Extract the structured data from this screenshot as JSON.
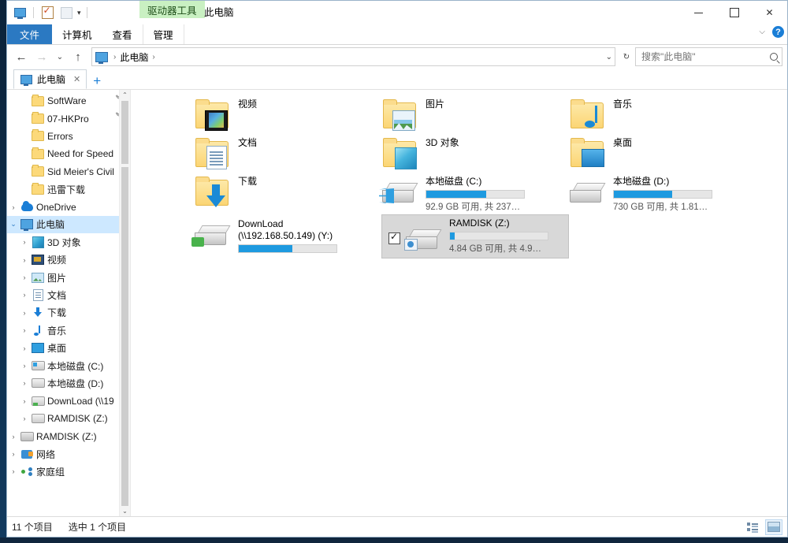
{
  "window": {
    "title": "此电脑",
    "contextual_tab_group": "驱动器工具",
    "minimize": "—",
    "maximize": "□",
    "close": "✕"
  },
  "quick_access_toolbar": {
    "items": [
      {
        "name": "properties-icon",
        "label": "属性"
      },
      {
        "name": "new-folder-icon",
        "label": "新建文件夹"
      },
      {
        "name": "customize-caret",
        "label": "▾"
      }
    ]
  },
  "ribbon": {
    "tabs": [
      {
        "label": "文件",
        "active": true
      },
      {
        "label": "计算机",
        "active": false
      },
      {
        "label": "查看",
        "active": false
      },
      {
        "label": "管理",
        "active": false
      }
    ],
    "collapse_caret": "⌵",
    "help": "?"
  },
  "addressbar": {
    "back": "←",
    "forward": "→",
    "recent_caret": "⌄",
    "up": "↑",
    "breadcrumb": [
      {
        "label": "此电脑"
      }
    ],
    "separator": "›",
    "history_caret": "⌄",
    "refresh": "↻",
    "search_placeholder": "搜索\"此电脑\""
  },
  "tabstrip": {
    "tabs": [
      {
        "label": "此电脑",
        "close": "✕"
      }
    ],
    "new_tab": "+"
  },
  "sidebar": {
    "items": [
      {
        "label": "SoftWare",
        "icon": "folder-icon",
        "indent": 1,
        "chevron": "",
        "pinned": true
      },
      {
        "label": "07-HKPro",
        "icon": "folder-icon",
        "indent": 1,
        "chevron": "",
        "pinned": true
      },
      {
        "label": "Errors",
        "icon": "folder-icon",
        "indent": 1,
        "chevron": "",
        "pinned": false
      },
      {
        "label": "Need for Speed",
        "icon": "folder-icon",
        "indent": 1,
        "chevron": "",
        "pinned": false
      },
      {
        "label": "Sid Meier's Civil",
        "icon": "folder-icon",
        "indent": 1,
        "chevron": "",
        "pinned": false
      },
      {
        "label": "迅雷下载",
        "icon": "folder-icon",
        "indent": 1,
        "chevron": "",
        "pinned": false
      },
      {
        "label": "OneDrive",
        "icon": "cloud-icon",
        "indent": 0,
        "chevron": "›",
        "pinned": false
      },
      {
        "label": "此电脑",
        "icon": "pc-icon",
        "indent": 0,
        "chevron": "⌄",
        "selected": true,
        "pinned": false
      },
      {
        "label": "3D 对象",
        "icon": "cube-icon",
        "indent": 1,
        "chevron": "›",
        "pinned": false
      },
      {
        "label": "视频",
        "icon": "video-icon",
        "indent": 1,
        "chevron": "›",
        "pinned": false
      },
      {
        "label": "图片",
        "icon": "picture-icon",
        "indent": 1,
        "chevron": "›",
        "pinned": false
      },
      {
        "label": "文档",
        "icon": "document-icon",
        "indent": 1,
        "chevron": "›",
        "pinned": false
      },
      {
        "label": "下载",
        "icon": "download-icon",
        "indent": 1,
        "chevron": "›",
        "pinned": false
      },
      {
        "label": "音乐",
        "icon": "music-icon",
        "indent": 1,
        "chevron": "›",
        "pinned": false
      },
      {
        "label": "桌面",
        "icon": "desktop-icon",
        "indent": 1,
        "chevron": "›",
        "pinned": false
      },
      {
        "label": "本地磁盘 (C:)",
        "icon": "windows-drive-icon",
        "indent": 1,
        "chevron": "›",
        "pinned": false
      },
      {
        "label": "本地磁盘 (D:)",
        "icon": "drive-icon",
        "indent": 1,
        "chevron": "›",
        "pinned": false
      },
      {
        "label": "DownLoad (\\\\19",
        "icon": "network-drive-icon",
        "indent": 1,
        "chevron": "›",
        "pinned": false
      },
      {
        "label": "RAMDISK (Z:)",
        "icon": "drive-icon",
        "indent": 1,
        "chevron": "›",
        "pinned": false
      },
      {
        "label": "RAMDISK (Z:)",
        "icon": "drive-plain-icon",
        "indent": 0,
        "chevron": "›",
        "pinned": false
      },
      {
        "label": "网络",
        "icon": "network-icon",
        "indent": 0,
        "chevron": "›",
        "pinned": false
      },
      {
        "label": "家庭组",
        "icon": "homegroup-icon",
        "indent": 0,
        "chevron": "›",
        "pinned": false
      }
    ],
    "scroll_up": "⌃",
    "scroll_down": "⌄"
  },
  "content": {
    "folders": [
      {
        "label": "视频",
        "icon": "video-folder-icon"
      },
      {
        "label": "图片",
        "icon": "picture-folder-icon"
      },
      {
        "label": "音乐",
        "icon": "music-folder-icon"
      },
      {
        "label": "文档",
        "icon": "document-folder-icon"
      },
      {
        "label": "3D 对象",
        "icon": "cube-folder-icon"
      },
      {
        "label": "桌面",
        "icon": "desktop-folder-icon"
      },
      {
        "label": "下载",
        "icon": "download-folder-icon"
      }
    ],
    "drives": [
      {
        "label": "本地磁盘 (C:)",
        "icon": "windows-drive-icon",
        "capacity_text": "92.9 GB 可用, 共 237…",
        "used_percent": 61,
        "selected": false
      },
      {
        "label": "本地磁盘 (D:)",
        "icon": "drive-icon",
        "capacity_text": "730 GB 可用, 共 1.81…",
        "used_percent": 60,
        "selected": false
      },
      {
        "label": "DownLoad (\\\\192.168.50.149) (Y:)",
        "icon": "network-drive-icon",
        "capacity_text": "",
        "used_percent": 55,
        "selected": false
      },
      {
        "label": "RAMDISK (Z:)",
        "icon": "share-drive-icon",
        "capacity_text": "4.84 GB 可用, 共 4.9…",
        "used_percent": 5,
        "selected": true,
        "checkbox": "✓"
      }
    ],
    "bar_color": "#1e9ae0"
  },
  "statusbar": {
    "item_count": "11 个项目",
    "selection": "选中 1 个项目",
    "views": [
      {
        "name": "details-view-button",
        "active": false
      },
      {
        "name": "large-icons-view-button",
        "active": true
      }
    ]
  }
}
